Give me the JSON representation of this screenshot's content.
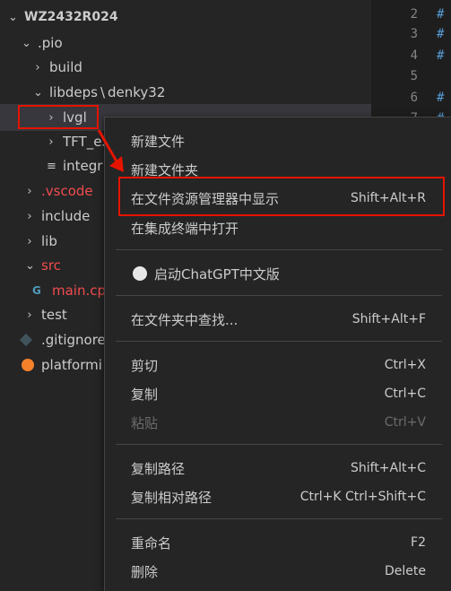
{
  "explorer": {
    "root_label": "WZ2432R024",
    "items": [
      {
        "label": "build"
      },
      {
        "label": ".pio"
      },
      {
        "label": "libdeps"
      },
      {
        "label": "\\"
      },
      {
        "label": "denky32"
      },
      {
        "label": "lvgl"
      },
      {
        "label": "TFT_eS"
      },
      {
        "label": "integr"
      },
      {
        "label": ".vscode"
      },
      {
        "label": "include"
      },
      {
        "label": "lib"
      },
      {
        "label": "src"
      },
      {
        "label": "main.cp"
      },
      {
        "label": "test"
      },
      {
        "label": ".gitignore"
      },
      {
        "label": "platformi"
      }
    ]
  },
  "editor": {
    "line_numbers": [
      "2",
      "3",
      "4",
      "5",
      "6",
      "7"
    ],
    "hash_glyph": "#"
  },
  "menu": {
    "new_file": "新建文件",
    "new_folder": "新建文件夹",
    "reveal": "在文件资源管理器中显示",
    "reveal_key": "Shift+Alt+R",
    "open_terminal": "在集成终端中打开",
    "chatgpt": "启动ChatGPT中文版",
    "find_in_folder": "在文件夹中查找...",
    "find_key": "Shift+Alt+F",
    "cut": "剪切",
    "cut_key": "Ctrl+X",
    "copy": "复制",
    "copy_key": "Ctrl+C",
    "paste": "粘贴",
    "paste_key": "Ctrl+V",
    "copy_path": "复制路径",
    "copy_path_key": "Shift+Alt+C",
    "copy_rel_path": "复制相对路径",
    "copy_rel_key": "Ctrl+K Ctrl+Shift+C",
    "rename": "重命名",
    "rename_key": "F2",
    "delete": "删除",
    "delete_key": "Delete"
  },
  "colors": {
    "highlight": "#e51400",
    "menu_bg": "#252526",
    "editor_bg": "#1e1e1e"
  }
}
